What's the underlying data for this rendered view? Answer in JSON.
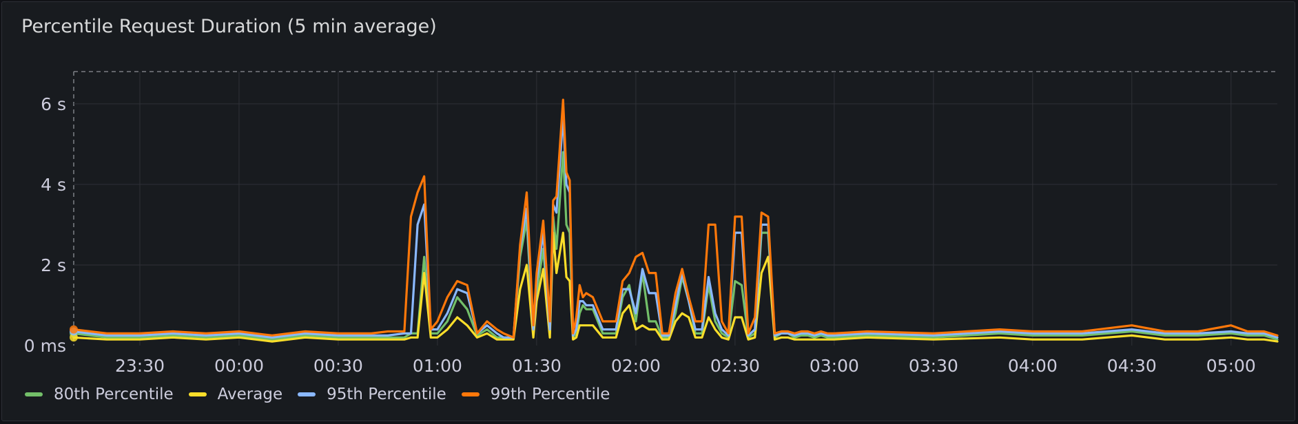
{
  "panel": {
    "title": "Percentile Request Duration (5 min average)"
  },
  "chart_data": {
    "type": "line",
    "title": "Percentile Request Duration (5 min average)",
    "xlabel": "",
    "ylabel": "",
    "y_unit": "seconds",
    "ylim": [
      0,
      6.8
    ],
    "xlim": [
      "23:10",
      "05:14"
    ],
    "y_ticks": [
      {
        "value": 0,
        "label": "0 ms"
      },
      {
        "value": 2,
        "label": "2 s"
      },
      {
        "value": 4,
        "label": "4 s"
      },
      {
        "value": 6,
        "label": "6 s"
      }
    ],
    "x_ticks": [
      {
        "value": "23:30",
        "label": "23:30"
      },
      {
        "value": "00:00",
        "label": "00:00"
      },
      {
        "value": "00:30",
        "label": "00:30"
      },
      {
        "value": "01:00",
        "label": "01:00"
      },
      {
        "value": "01:30",
        "label": "01:30"
      },
      {
        "value": "02:00",
        "label": "02:00"
      },
      {
        "value": "02:30",
        "label": "02:30"
      },
      {
        "value": "03:00",
        "label": "03:00"
      },
      {
        "value": "03:30",
        "label": "03:30"
      },
      {
        "value": "04:00",
        "label": "04:00"
      },
      {
        "value": "04:30",
        "label": "04:30"
      },
      {
        "value": "05:00",
        "label": "05:00"
      }
    ],
    "grid": true,
    "legend_position": "bottom-left",
    "x": [
      "23:10",
      "23:20",
      "23:30",
      "23:40",
      "23:50",
      "00:00",
      "00:10",
      "00:20",
      "00:30",
      "00:40",
      "00:45",
      "00:50",
      "00:52",
      "00:54",
      "00:56",
      "00:58",
      "01:00",
      "01:03",
      "01:06",
      "01:09",
      "01:12",
      "01:15",
      "01:18",
      "01:20",
      "01:23",
      "01:25",
      "01:27",
      "01:29",
      "01:30",
      "01:32",
      "01:34",
      "01:35",
      "01:36",
      "01:38",
      "01:39",
      "01:40",
      "01:41",
      "01:42",
      "01:43",
      "01:44",
      "01:45",
      "01:47",
      "01:50",
      "01:52",
      "01:54",
      "01:56",
      "01:58",
      "02:00",
      "02:02",
      "02:04",
      "02:06",
      "02:08",
      "02:10",
      "02:12",
      "02:14",
      "02:16",
      "02:18",
      "02:20",
      "02:22",
      "02:24",
      "02:26",
      "02:28",
      "02:30",
      "02:32",
      "02:34",
      "02:36",
      "02:38",
      "02:40",
      "02:42",
      "02:44",
      "02:46",
      "02:48",
      "02:50",
      "02:52",
      "02:54",
      "02:56",
      "02:58",
      "03:00",
      "03:10",
      "03:30",
      "03:50",
      "04:00",
      "04:15",
      "04:30",
      "04:40",
      "04:50",
      "05:00",
      "05:05",
      "05:10",
      "05:14"
    ],
    "series": [
      {
        "name": "80th Percentile",
        "color": "#73bf69",
        "values": [
          0.3,
          0.2,
          0.2,
          0.25,
          0.2,
          0.25,
          0.15,
          0.25,
          0.2,
          0.2,
          0.2,
          0.2,
          0.3,
          0.3,
          2.2,
          0.3,
          0.3,
          0.6,
          1.2,
          0.9,
          0.25,
          0.4,
          0.2,
          0.2,
          0.2,
          2.2,
          3.1,
          0.3,
          1.3,
          2.4,
          0.3,
          3.2,
          2.4,
          4.8,
          3.0,
          2.8,
          0.2,
          0.3,
          0.8,
          1.0,
          0.9,
          0.9,
          0.3,
          0.3,
          0.3,
          1.2,
          1.5,
          0.6,
          1.8,
          0.6,
          0.6,
          0.2,
          0.2,
          0.8,
          1.7,
          1.1,
          0.3,
          0.3,
          1.5,
          0.6,
          0.3,
          0.2,
          1.6,
          1.5,
          0.2,
          0.3,
          2.8,
          2.8,
          0.2,
          0.3,
          0.3,
          0.2,
          0.25,
          0.25,
          0.2,
          0.25,
          0.2,
          0.2,
          0.25,
          0.2,
          0.3,
          0.25,
          0.25,
          0.35,
          0.25,
          0.25,
          0.3,
          0.25,
          0.25,
          0.15
        ]
      },
      {
        "name": "Average",
        "color": "#fade2a",
        "values": [
          0.2,
          0.15,
          0.15,
          0.2,
          0.15,
          0.2,
          0.1,
          0.2,
          0.15,
          0.15,
          0.15,
          0.15,
          0.2,
          0.2,
          1.8,
          0.2,
          0.2,
          0.4,
          0.7,
          0.5,
          0.2,
          0.3,
          0.15,
          0.15,
          0.15,
          1.4,
          2.0,
          0.2,
          1.1,
          1.9,
          0.2,
          2.8,
          1.8,
          2.8,
          1.7,
          1.6,
          0.15,
          0.2,
          0.5,
          0.5,
          0.5,
          0.5,
          0.2,
          0.2,
          0.2,
          0.8,
          1.0,
          0.4,
          0.5,
          0.4,
          0.4,
          0.15,
          0.15,
          0.6,
          0.8,
          0.7,
          0.2,
          0.2,
          0.7,
          0.4,
          0.2,
          0.15,
          0.7,
          0.7,
          0.15,
          0.2,
          1.8,
          2.2,
          0.15,
          0.2,
          0.2,
          0.15,
          0.15,
          0.15,
          0.15,
          0.15,
          0.15,
          0.15,
          0.2,
          0.15,
          0.2,
          0.15,
          0.15,
          0.25,
          0.15,
          0.15,
          0.2,
          0.15,
          0.15,
          0.1
        ]
      },
      {
        "name": "95th Percentile",
        "color": "#8ab8ff",
        "values": [
          0.35,
          0.25,
          0.25,
          0.3,
          0.25,
          0.3,
          0.2,
          0.3,
          0.25,
          0.25,
          0.25,
          0.3,
          0.3,
          3.0,
          3.5,
          0.4,
          0.4,
          0.8,
          1.4,
          1.3,
          0.3,
          0.5,
          0.3,
          0.2,
          0.2,
          2.4,
          3.4,
          0.4,
          1.6,
          2.8,
          0.4,
          3.5,
          3.3,
          5.7,
          4.0,
          3.8,
          0.25,
          0.4,
          1.1,
          1.1,
          1.0,
          1.0,
          0.4,
          0.4,
          0.4,
          1.4,
          1.4,
          0.8,
          1.9,
          1.3,
          1.3,
          0.25,
          0.25,
          1.0,
          1.8,
          1.1,
          0.4,
          0.4,
          1.7,
          0.8,
          0.4,
          0.25,
          2.8,
          2.8,
          0.25,
          0.4,
          3.0,
          3.0,
          0.25,
          0.3,
          0.3,
          0.25,
          0.3,
          0.3,
          0.25,
          0.3,
          0.25,
          0.25,
          0.3,
          0.25,
          0.35,
          0.3,
          0.3,
          0.4,
          0.3,
          0.3,
          0.35,
          0.3,
          0.3,
          0.2
        ]
      },
      {
        "name": "99th Percentile",
        "color": "#ff780a",
        "values": [
          0.4,
          0.3,
          0.3,
          0.35,
          0.3,
          0.35,
          0.25,
          0.35,
          0.3,
          0.3,
          0.35,
          0.35,
          3.2,
          3.8,
          4.2,
          0.4,
          0.6,
          1.2,
          1.6,
          1.5,
          0.3,
          0.6,
          0.4,
          0.3,
          0.2,
          2.5,
          3.8,
          0.5,
          1.8,
          3.1,
          0.6,
          3.6,
          3.7,
          6.1,
          4.3,
          4.1,
          0.3,
          0.7,
          1.5,
          1.2,
          1.3,
          1.2,
          0.6,
          0.6,
          0.6,
          1.6,
          1.8,
          2.2,
          2.3,
          1.8,
          1.8,
          0.3,
          0.3,
          1.3,
          1.9,
          1.2,
          0.6,
          0.6,
          3.0,
          3.0,
          0.6,
          0.3,
          3.2,
          3.2,
          0.3,
          0.7,
          3.3,
          3.2,
          0.3,
          0.35,
          0.35,
          0.3,
          0.35,
          0.35,
          0.3,
          0.35,
          0.3,
          0.3,
          0.35,
          0.3,
          0.4,
          0.35,
          0.35,
          0.5,
          0.35,
          0.35,
          0.5,
          0.35,
          0.35,
          0.25
        ]
      }
    ]
  },
  "legend": {
    "items": [
      {
        "label": "80th Percentile",
        "color": "#73bf69"
      },
      {
        "label": "Average",
        "color": "#fade2a"
      },
      {
        "label": "95th Percentile",
        "color": "#8ab8ff"
      },
      {
        "label": "99th Percentile",
        "color": "#ff780a"
      }
    ]
  },
  "colors": {
    "panel_bg": "#181b1f",
    "grid": "#2f3137",
    "text": "#ccccdc"
  }
}
